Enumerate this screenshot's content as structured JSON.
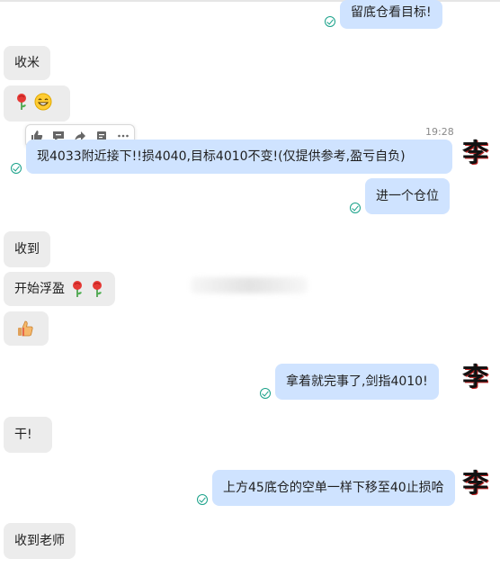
{
  "messages": {
    "m1": "留底仓看目标!",
    "m2": "收米",
    "m4": "现4033附近接下!!损4040,目标4010不变!(仅提供参考,盈亏自负)",
    "m5": "进一个仓位",
    "m6": "收到",
    "m7": "开始浮盈",
    "m9": "拿着就完事了,剑指4010!",
    "m10": "干!",
    "m11": "上方45底仓的空单一样下移至40止损哈",
    "m12": "收到老师"
  },
  "timestamp": "19:28",
  "avatar_char": "李",
  "colors": {
    "incoming_bubble": "#ececec",
    "outgoing_bubble": "#cfe3ff",
    "check": "#19a189"
  },
  "icons": [
    "thumbs-up-icon",
    "comment-icon",
    "forward-icon",
    "quote-icon",
    "more-icon",
    "rose-icon",
    "grin-icon",
    "check-icon"
  ]
}
